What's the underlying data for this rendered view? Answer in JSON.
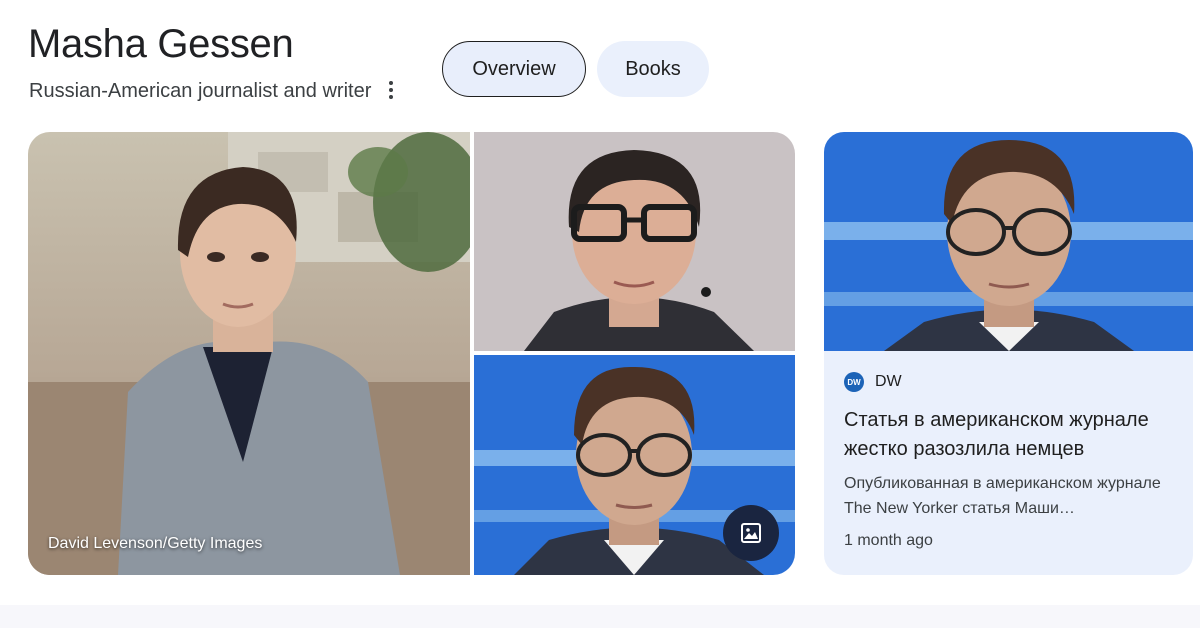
{
  "entity": {
    "title": "Masha Gessen",
    "subtitle": "Russian-American journalist and writer"
  },
  "menu": {
    "icon": "more-vert-icon"
  },
  "tabs": [
    {
      "label": "Overview",
      "selected": true
    },
    {
      "label": "Books",
      "selected": false
    }
  ],
  "gallery": {
    "images": [
      {
        "subject": "portrait-grey-blazer-outdoors",
        "credit": "David Levenson/Getty Images"
      },
      {
        "subject": "portrait-glasses-microphone"
      },
      {
        "subject": "portrait-glasses-blue-stage"
      }
    ],
    "more_images_icon": "image-icon"
  },
  "news": {
    "source": "DW",
    "source_logo_text": "DW",
    "headline": "Статья в американском журнале жестко разозлила немцев",
    "snippet": "Опубликованная в американском журнале The New Yorker статья Маши…",
    "time": "1 month ago"
  },
  "colors": {
    "chip_bg": "#e8eefb",
    "card_bg": "#eaf0fc",
    "dw_blue": "#1c63b7",
    "stage_blue": "#2a6fd6"
  }
}
